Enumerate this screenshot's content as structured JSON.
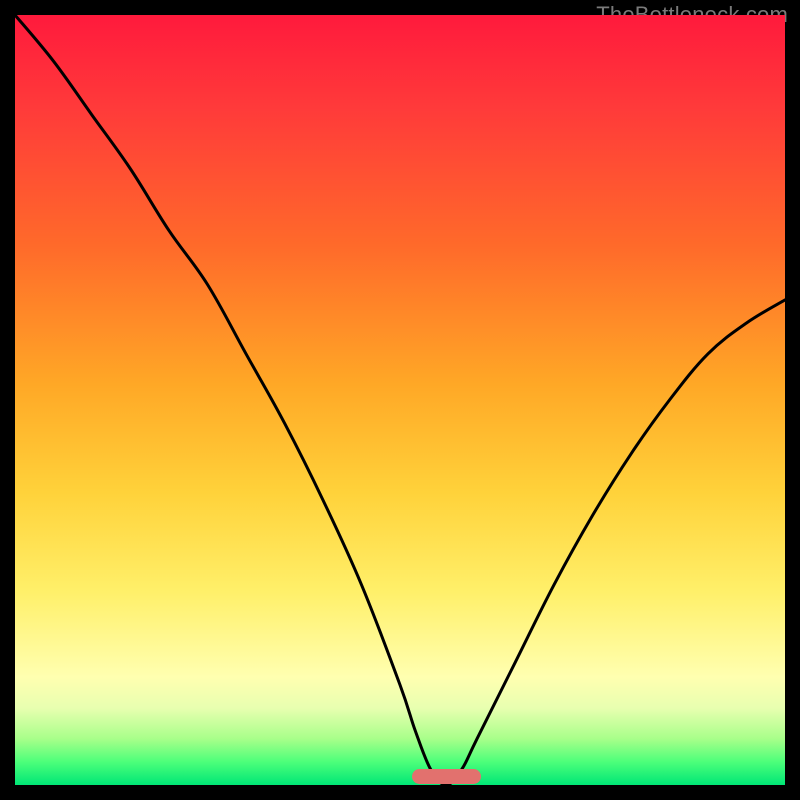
{
  "attribution": "TheBottleneck.com",
  "colors": {
    "gradient_top": "#ff1a3c",
    "gradient_mid1": "#ff6a2a",
    "gradient_mid2": "#ffd23a",
    "gradient_mid3": "#ffffb0",
    "gradient_bottom": "#00e676",
    "curve": "#000000",
    "marker": "#e2716e",
    "frame": "#000000"
  },
  "chart_data": {
    "type": "line",
    "title": "",
    "xlabel": "",
    "ylabel": "",
    "xlim": [
      0,
      100
    ],
    "ylim": [
      0,
      100
    ],
    "grid": false,
    "legend": false,
    "series": [
      {
        "name": "bottleneck-curve",
        "x": [
          0,
          5,
          10,
          15,
          20,
          25,
          30,
          35,
          40,
          45,
          50,
          52,
          54,
          56,
          58,
          60,
          65,
          70,
          75,
          80,
          85,
          90,
          95,
          100
        ],
        "values": [
          100,
          94,
          87,
          80,
          72,
          65,
          56,
          47,
          37,
          26,
          13,
          7,
          2,
          0,
          2,
          6,
          16,
          26,
          35,
          43,
          50,
          56,
          60,
          63
        ]
      }
    ],
    "marker": {
      "x_center": 56,
      "width": 9,
      "height": 2
    },
    "note": "Values are estimated from pixel positions; axes have no visible tick labels. y maps linearly green(0) at bottom to red(100) at top."
  }
}
